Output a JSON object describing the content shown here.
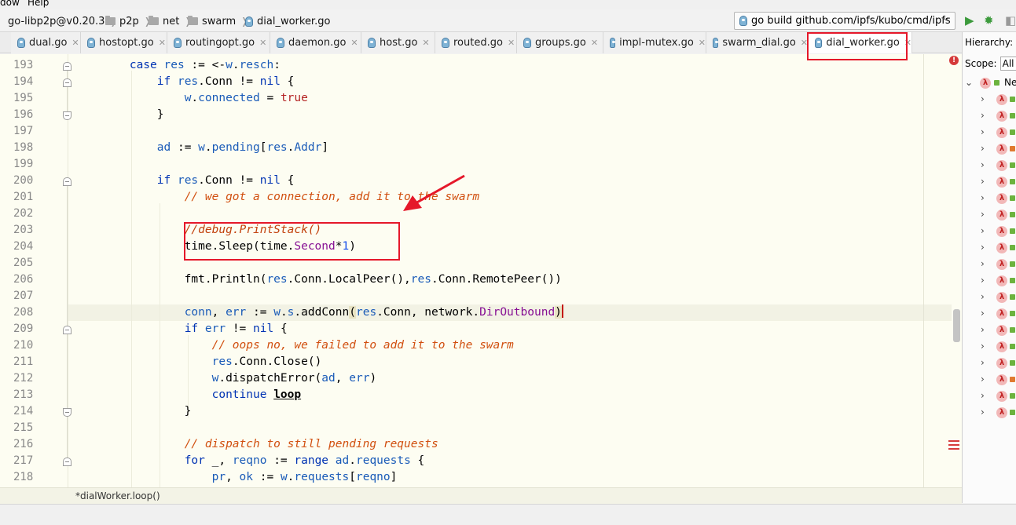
{
  "menu": {
    "items": [
      "dow",
      "Help"
    ]
  },
  "nav": {
    "crumbs": [
      "go-libp2p@v0.20.3",
      "p2p",
      "net",
      "swarm",
      "dial_worker.go"
    ],
    "run_config": "go build github.com/ipfs/kubo/cmd/ipfs"
  },
  "tabs": [
    "dual.go",
    "hostopt.go",
    "routingopt.go",
    "daemon.go",
    "host.go",
    "routed.go",
    "groups.go",
    "impl-mutex.go",
    "swarm_dial.go",
    "dial_worker.go"
  ],
  "active_tab": "dial_worker.go",
  "hierarchy": {
    "title": "Hierarchy:",
    "scope_label": "Scope:",
    "scope_value": "All",
    "root_label": "Ne"
  },
  "editor": {
    "line_numbers": [
      "193",
      "194",
      "195",
      "196",
      "197",
      "198",
      "199",
      "200",
      "201",
      "202",
      "203",
      "204",
      "205",
      "206",
      "207",
      "208",
      "209",
      "210",
      "211",
      "212",
      "213",
      "214",
      "215",
      "216",
      "217",
      "218"
    ],
    "breadcrumb": "*dialWorker.loop()"
  },
  "colors": {
    "annotation": "#e5182a",
    "keyword": "#0033b3",
    "comment": "#d14f0f"
  }
}
